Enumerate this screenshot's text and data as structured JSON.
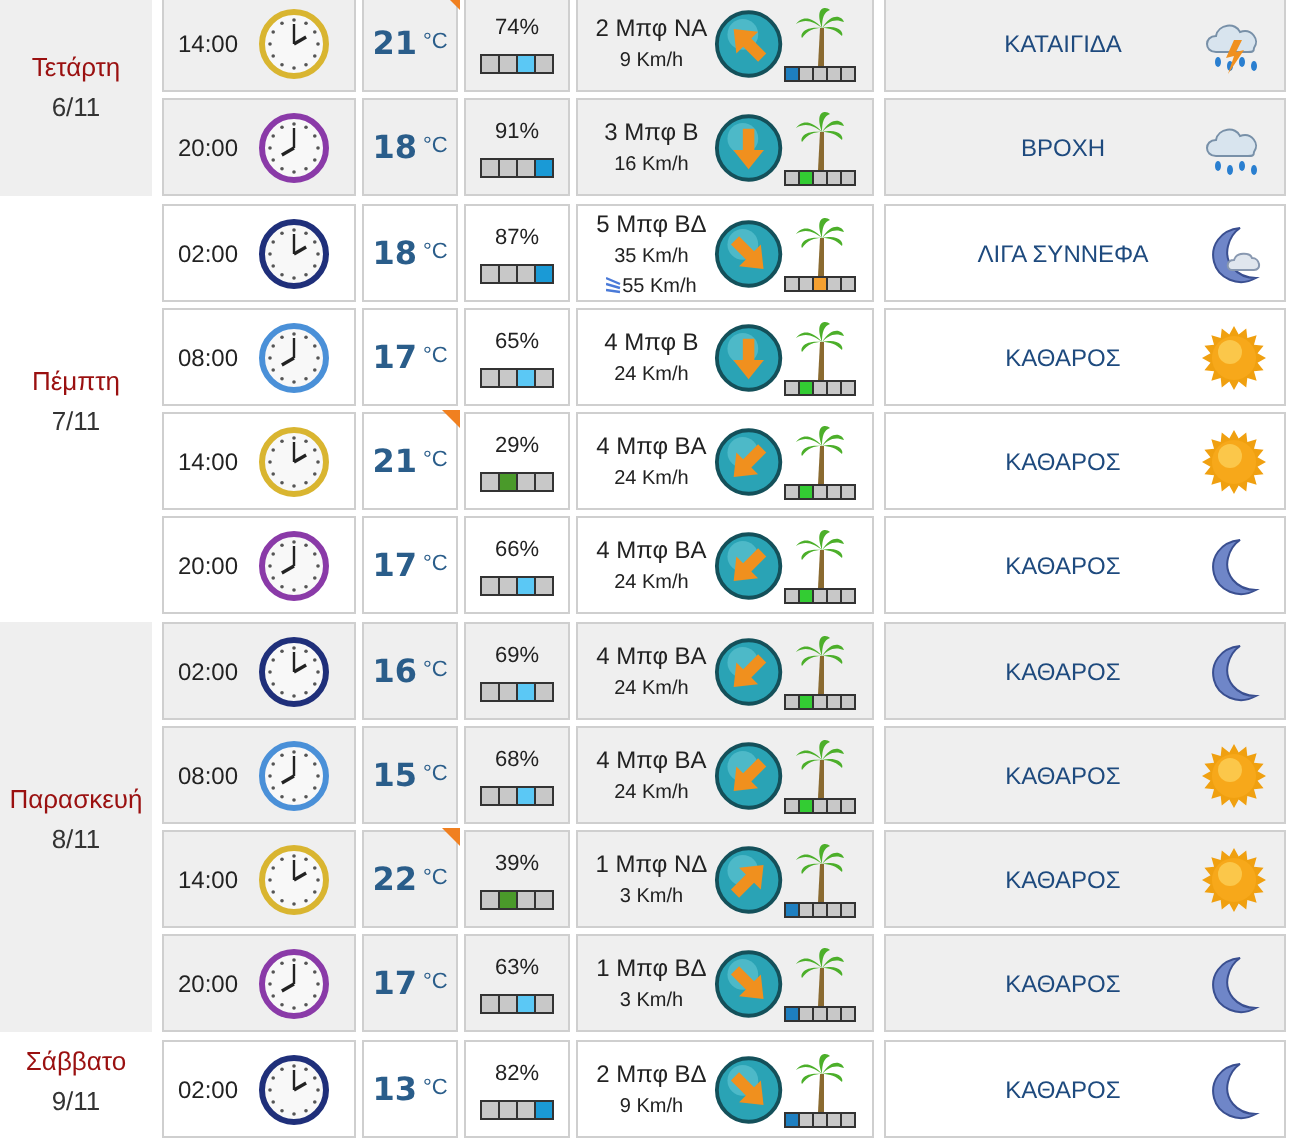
{
  "days": [
    {
      "name": "Τετάρτη",
      "date": "6/11",
      "shaded": true,
      "rows": [
        {
          "time": "14:00",
          "clock": {
            "color": "#d9b530",
            "kind": "two"
          },
          "temp": "21",
          "unit": "°C",
          "max_marker": true,
          "humidity": "74%",
          "humidity_bar": [
            {
              "color": "#c8c8c8"
            },
            {
              "color": "#c8c8c8"
            },
            {
              "color": "#5bc8f5"
            },
            {
              "color": "#c8c8c8"
            }
          ],
          "wind": "2 Μπφ ΝΑ",
          "speed": "9 Km/h",
          "wind_arrow": {
            "kind": "up-left"
          },
          "beaufort_bar": [
            {
              "color": "#1e7fc0"
            },
            {
              "color": "#c8c8c8"
            },
            {
              "color": "#c8c8c8"
            },
            {
              "color": "#c8c8c8"
            },
            {
              "color": "#c8c8c8"
            }
          ],
          "condition": "ΚΑΤΑΙΓΙΔΑ",
          "condition_icon": {
            "kind": "storm"
          }
        },
        {
          "time": "20:00",
          "clock": {
            "color": "#8a3aa8",
            "kind": "eight"
          },
          "temp": "18",
          "unit": "°C",
          "max_marker": false,
          "humidity": "91%",
          "humidity_bar": [
            {
              "color": "#c8c8c8"
            },
            {
              "color": "#c8c8c8"
            },
            {
              "color": "#c8c8c8"
            },
            {
              "color": "#1a9ad6"
            }
          ],
          "wind": "3 Μπφ Β",
          "speed": "16 Km/h",
          "wind_arrow": {
            "kind": "down"
          },
          "beaufort_bar": [
            {
              "color": "#c8c8c8"
            },
            {
              "color": "#33cc33"
            },
            {
              "color": "#c8c8c8"
            },
            {
              "color": "#c8c8c8"
            },
            {
              "color": "#c8c8c8"
            }
          ],
          "condition": "ΒΡΟΧΗ",
          "condition_icon": {
            "kind": "rain"
          }
        }
      ]
    },
    {
      "name": "Πέμπτη",
      "date": "7/11",
      "shaded": false,
      "rows": [
        {
          "time": "02:00",
          "clock": {
            "color": "#1f2f7a",
            "kind": "two"
          },
          "temp": "18",
          "unit": "°C",
          "max_marker": false,
          "humidity": "87%",
          "humidity_bar": [
            {
              "color": "#c8c8c8"
            },
            {
              "color": "#c8c8c8"
            },
            {
              "color": "#c8c8c8"
            },
            {
              "color": "#1a9ad6"
            }
          ],
          "wind": "5 Μπφ ΒΔ",
          "speed": "35 Km/h",
          "gust": "55 Km/h",
          "wind_arrow": {
            "kind": "down-right"
          },
          "beaufort_bar": [
            {
              "color": "#c8c8c8"
            },
            {
              "color": "#c8c8c8"
            },
            {
              "color": "#f5a030"
            },
            {
              "color": "#c8c8c8"
            },
            {
              "color": "#c8c8c8"
            }
          ],
          "condition": "ΛΙΓΑ ΣΥΝΝΕΦΑ",
          "condition_icon": {
            "kind": "moon-cloud"
          }
        },
        {
          "time": "08:00",
          "clock": {
            "color": "#4a90d8",
            "kind": "eight"
          },
          "temp": "17",
          "unit": "°C",
          "max_marker": false,
          "humidity": "65%",
          "humidity_bar": [
            {
              "color": "#c8c8c8"
            },
            {
              "color": "#c8c8c8"
            },
            {
              "color": "#5bc8f5"
            },
            {
              "color": "#c8c8c8"
            }
          ],
          "wind": "4 Μπφ Β",
          "speed": "24 Km/h",
          "wind_arrow": {
            "kind": "down"
          },
          "beaufort_bar": [
            {
              "color": "#c8c8c8"
            },
            {
              "color": "#33cc33"
            },
            {
              "color": "#c8c8c8"
            },
            {
              "color": "#c8c8c8"
            },
            {
              "color": "#c8c8c8"
            }
          ],
          "condition": "ΚΑΘΑΡΟΣ",
          "condition_icon": {
            "kind": "sun"
          }
        },
        {
          "time": "14:00",
          "clock": {
            "color": "#d9b530",
            "kind": "two"
          },
          "temp": "21",
          "unit": "°C",
          "max_marker": true,
          "humidity": "29%",
          "humidity_bar": [
            {
              "color": "#c8c8c8"
            },
            {
              "color": "#4a9a2a"
            },
            {
              "color": "#c8c8c8"
            },
            {
              "color": "#c8c8c8"
            }
          ],
          "wind": "4 Μπφ ΒΑ",
          "speed": "24 Km/h",
          "wind_arrow": {
            "kind": "down-left"
          },
          "beaufort_bar": [
            {
              "color": "#c8c8c8"
            },
            {
              "color": "#33cc33"
            },
            {
              "color": "#c8c8c8"
            },
            {
              "color": "#c8c8c8"
            },
            {
              "color": "#c8c8c8"
            }
          ],
          "condition": "ΚΑΘΑΡΟΣ",
          "condition_icon": {
            "kind": "sun"
          }
        },
        {
          "time": "20:00",
          "clock": {
            "color": "#8a3aa8",
            "kind": "eight"
          },
          "temp": "17",
          "unit": "°C",
          "max_marker": false,
          "humidity": "66%",
          "humidity_bar": [
            {
              "color": "#c8c8c8"
            },
            {
              "color": "#c8c8c8"
            },
            {
              "color": "#5bc8f5"
            },
            {
              "color": "#c8c8c8"
            }
          ],
          "wind": "4 Μπφ ΒΑ",
          "speed": "24 Km/h",
          "wind_arrow": {
            "kind": "down-left"
          },
          "beaufort_bar": [
            {
              "color": "#c8c8c8"
            },
            {
              "color": "#33cc33"
            },
            {
              "color": "#c8c8c8"
            },
            {
              "color": "#c8c8c8"
            },
            {
              "color": "#c8c8c8"
            }
          ],
          "condition": "ΚΑΘΑΡΟΣ",
          "condition_icon": {
            "kind": "moon"
          }
        }
      ]
    },
    {
      "name": "Παρασκευή",
      "date": "8/11",
      "shaded": true,
      "rows": [
        {
          "time": "02:00",
          "clock": {
            "color": "#1f2f7a",
            "kind": "two"
          },
          "temp": "16",
          "unit": "°C",
          "max_marker": false,
          "humidity": "69%",
          "humidity_bar": [
            {
              "color": "#c8c8c8"
            },
            {
              "color": "#c8c8c8"
            },
            {
              "color": "#5bc8f5"
            },
            {
              "color": "#c8c8c8"
            }
          ],
          "wind": "4 Μπφ ΒΑ",
          "speed": "24 Km/h",
          "wind_arrow": {
            "kind": "down-left"
          },
          "beaufort_bar": [
            {
              "color": "#c8c8c8"
            },
            {
              "color": "#33cc33"
            },
            {
              "color": "#c8c8c8"
            },
            {
              "color": "#c8c8c8"
            },
            {
              "color": "#c8c8c8"
            }
          ],
          "condition": "ΚΑΘΑΡΟΣ",
          "condition_icon": {
            "kind": "moon"
          }
        },
        {
          "time": "08:00",
          "clock": {
            "color": "#4a90d8",
            "kind": "eight"
          },
          "temp": "15",
          "unit": "°C",
          "max_marker": false,
          "humidity": "68%",
          "humidity_bar": [
            {
              "color": "#c8c8c8"
            },
            {
              "color": "#c8c8c8"
            },
            {
              "color": "#5bc8f5"
            },
            {
              "color": "#c8c8c8"
            }
          ],
          "wind": "4 Μπφ ΒΑ",
          "speed": "24 Km/h",
          "wind_arrow": {
            "kind": "down-left"
          },
          "beaufort_bar": [
            {
              "color": "#c8c8c8"
            },
            {
              "color": "#33cc33"
            },
            {
              "color": "#c8c8c8"
            },
            {
              "color": "#c8c8c8"
            },
            {
              "color": "#c8c8c8"
            }
          ],
          "condition": "ΚΑΘΑΡΟΣ",
          "condition_icon": {
            "kind": "sun"
          }
        },
        {
          "time": "14:00",
          "clock": {
            "color": "#d9b530",
            "kind": "two"
          },
          "temp": "22",
          "unit": "°C",
          "max_marker": true,
          "humidity": "39%",
          "humidity_bar": [
            {
              "color": "#c8c8c8"
            },
            {
              "color": "#4a9a2a"
            },
            {
              "color": "#c8c8c8"
            },
            {
              "color": "#c8c8c8"
            }
          ],
          "wind": "1 Μπφ ΝΔ",
          "speed": "3 Km/h",
          "wind_arrow": {
            "kind": "up-right"
          },
          "beaufort_bar": [
            {
              "color": "#1e7fc0"
            },
            {
              "color": "#c8c8c8"
            },
            {
              "color": "#c8c8c8"
            },
            {
              "color": "#c8c8c8"
            },
            {
              "color": "#c8c8c8"
            }
          ],
          "condition": "ΚΑΘΑΡΟΣ",
          "condition_icon": {
            "kind": "sun"
          }
        },
        {
          "time": "20:00",
          "clock": {
            "color": "#8a3aa8",
            "kind": "eight"
          },
          "temp": "17",
          "unit": "°C",
          "max_marker": false,
          "humidity": "63%",
          "humidity_bar": [
            {
              "color": "#c8c8c8"
            },
            {
              "color": "#c8c8c8"
            },
            {
              "color": "#5bc8f5"
            },
            {
              "color": "#c8c8c8"
            }
          ],
          "wind": "1 Μπφ ΒΔ",
          "speed": "3 Km/h",
          "wind_arrow": {
            "kind": "down-right"
          },
          "beaufort_bar": [
            {
              "color": "#1e7fc0"
            },
            {
              "color": "#c8c8c8"
            },
            {
              "color": "#c8c8c8"
            },
            {
              "color": "#c8c8c8"
            },
            {
              "color": "#c8c8c8"
            }
          ],
          "condition": "ΚΑΘΑΡΟΣ",
          "condition_icon": {
            "kind": "moon"
          }
        }
      ]
    },
    {
      "name": "Σάββατο",
      "date": "9/11",
      "shaded": false,
      "rows": [
        {
          "time": "02:00",
          "clock": {
            "color": "#1f2f7a",
            "kind": "two"
          },
          "temp": "13",
          "unit": "°C",
          "max_marker": false,
          "humidity": "82%",
          "humidity_bar": [
            {
              "color": "#c8c8c8"
            },
            {
              "color": "#c8c8c8"
            },
            {
              "color": "#c8c8c8"
            },
            {
              "color": "#1a9ad6"
            }
          ],
          "wind": "2 Μπφ ΒΔ",
          "speed": "9 Km/h",
          "wind_arrow": {
            "kind": "down-right"
          },
          "beaufort_bar": [
            {
              "color": "#1e7fc0"
            },
            {
              "color": "#c8c8c8"
            },
            {
              "color": "#c8c8c8"
            },
            {
              "color": "#c8c8c8"
            },
            {
              "color": "#c8c8c8"
            }
          ],
          "condition": "ΚΑΘΑΡΟΣ",
          "condition_icon": {
            "kind": "moon"
          }
        }
      ]
    }
  ]
}
